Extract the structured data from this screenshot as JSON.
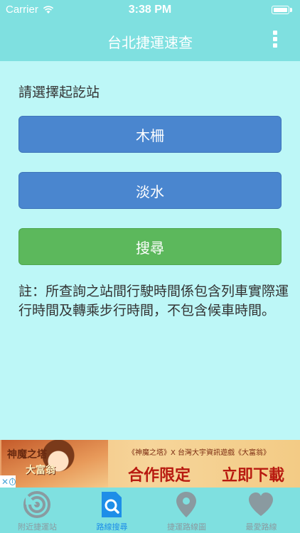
{
  "status": {
    "carrier": "Carrier",
    "time": "3:38 PM"
  },
  "nav": {
    "title": "台北捷運速查"
  },
  "main": {
    "prompt": "請選擇起訖站",
    "origin_station": "木柵",
    "destination_station": "淡水",
    "search_label": "搜尋",
    "note": "註：所查詢之站間行駛時間係包含列車實際運行時間及轉乘步行時間，不包含候車時間。"
  },
  "ad": {
    "logo_line1": "神魔之塔",
    "logo_line2": "大富翁",
    "headline_top": "《神魔之塔》X 台灣大宇資訊遊戲《大富翁》",
    "headline_left": "合作限定",
    "headline_right": "立即下載"
  },
  "tabs": [
    {
      "label": "附近捷運站",
      "icon": "radar-icon",
      "active": false
    },
    {
      "label": "路線搜尋",
      "icon": "search-icon",
      "active": true
    },
    {
      "label": "捷運路線圖",
      "icon": "map-pin-icon",
      "active": false
    },
    {
      "label": "最愛路線",
      "icon": "heart-icon",
      "active": false
    }
  ],
  "colors": {
    "background": "#bdf7f7",
    "bar": "#7fe0e0",
    "button_blue": "#4a86cf",
    "button_green": "#5cb85c",
    "tab_active": "#1e8ee8",
    "tab_inactive": "#8a9aa0"
  }
}
